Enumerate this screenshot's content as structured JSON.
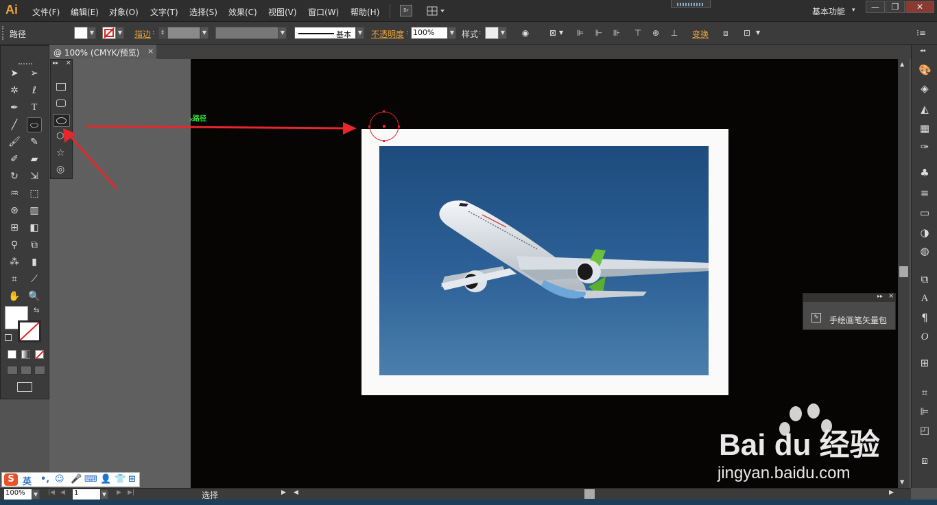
{
  "app": {
    "logo": "Ai",
    "workspace": "基本功能"
  },
  "menu": [
    "文件(F)",
    "编辑(E)",
    "对象(O)",
    "文字(T)",
    "选择(S)",
    "效果(C)",
    "视图(V)",
    "窗口(W)",
    "帮助(H)"
  ],
  "br_label": "Br",
  "window_buttons": {
    "minimize": "—",
    "restore": "❐",
    "close": "✕"
  },
  "controlbar": {
    "object_type": "路径",
    "stroke_label": "描边",
    "profile_label": "基本",
    "opacity_label": "不透明度",
    "opacity_value": "100%",
    "style_label": "样式",
    "transform_label": "变换"
  },
  "document": {
    "tab_title": "@ 100% (CMYK/预览)",
    "tab_close": "×"
  },
  "canvas_hint": "路径",
  "floating_panel": {
    "brush_library": "手绘画笔矢量包"
  },
  "statusbar": {
    "zoom": "100%",
    "page": "1",
    "status": "选择"
  },
  "ime": {
    "lang": "英"
  },
  "watermark": {
    "brand": "Bai du 经验",
    "url": "jingyan.baidu.com"
  },
  "colors": {
    "annotation_arrow": "#e8272b",
    "accent_orange": "#e7a23c",
    "canvas": "#070404"
  }
}
